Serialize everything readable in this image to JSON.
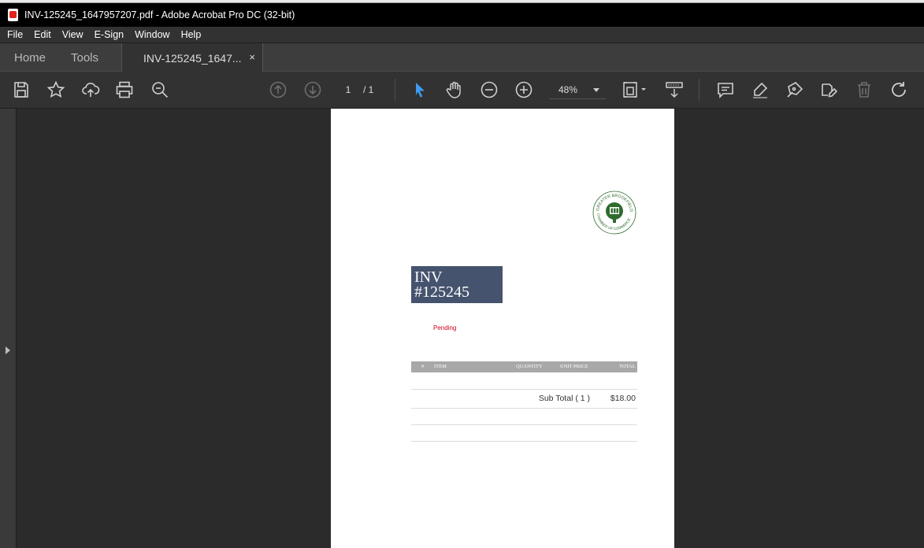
{
  "window": {
    "title": "INV-125245_1647957207.pdf - Adobe Acrobat Pro DC (32-bit)"
  },
  "menu": [
    "File",
    "Edit",
    "View",
    "E-Sign",
    "Window",
    "Help"
  ],
  "tabs": {
    "home": "Home",
    "tools": "Tools",
    "document": "INV-125245_1647...",
    "close": "×"
  },
  "toolbar": {
    "icons": [
      "save-icon",
      "bookmark-star-icon",
      "upload-cloud-icon",
      "print-icon",
      "zoom-search-icon",
      "page-up-icon",
      "page-down-icon",
      "select-pointer-icon",
      "hand-icon",
      "zoom-out-icon",
      "zoom-in-icon",
      "page-fit-icon",
      "scroll-mode-icon",
      "comment-icon",
      "highlight-icon",
      "draw-icon",
      "fill-sign-icon",
      "delete-icon",
      "rotate-icon"
    ],
    "page_current": "1",
    "page_total": "/ 1",
    "zoom": "48%"
  },
  "document": {
    "invoice_title": "INV\n#125245",
    "invoice_line1": "INV",
    "invoice_line2": "#125245",
    "status": "Pending",
    "status_color": "#d0021b",
    "header_color": "#46536e",
    "table": {
      "columns": [
        "#",
        "ITEM",
        "QUANTITY",
        "UNIT PRICE",
        "TOTAL"
      ]
    },
    "subtotal_label": "Sub Total ( 1 )",
    "subtotal_value": "$18.00",
    "logo": {
      "arc_text_top": "GREATER BROOKFIELD",
      "arc_text_bottom": "CHAMBER OF COMMERCE",
      "color": "#2f6b2f"
    }
  }
}
